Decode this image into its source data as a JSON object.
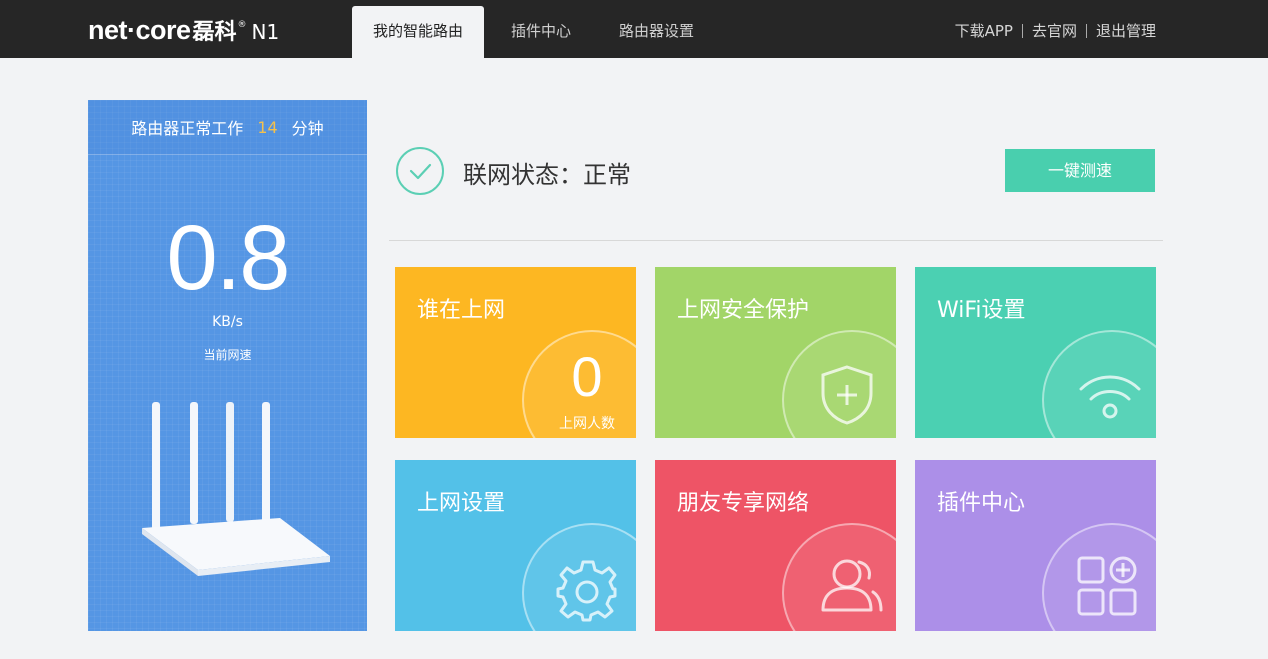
{
  "brand": {
    "name": "net·core",
    "cn": "磊科",
    "reg": "®",
    "model": "N1"
  },
  "nav": {
    "tabs": [
      {
        "label": "我的智能路由",
        "active": true
      },
      {
        "label": "插件中心",
        "active": false
      },
      {
        "label": "路由器设置",
        "active": false
      }
    ]
  },
  "header_links": [
    "下载APP",
    "去官网",
    "退出管理"
  ],
  "panel": {
    "uptime_prefix": "路由器正常工作",
    "uptime_minutes": "14",
    "uptime_unit": "分钟",
    "speed_value": "0.8",
    "speed_unit": "KB/s",
    "speed_label": "当前网速"
  },
  "status": {
    "title": "联网状态：正常",
    "speedtest_label": "一键测速"
  },
  "tiles": [
    {
      "title": "谁在上网",
      "count": "0",
      "count_label": "上网人数",
      "icon": "users-count"
    },
    {
      "title": "上网安全保护",
      "icon": "shield-plus-icon"
    },
    {
      "title": "WiFi设置",
      "icon": "wifi-icon"
    },
    {
      "title": "上网设置",
      "icon": "gear-icon"
    },
    {
      "title": "朋友专享网络",
      "icon": "users-icon"
    },
    {
      "title": "插件中心",
      "icon": "plugins-icon"
    }
  ],
  "colors": {
    "topbar": "#262626",
    "panel": "#5596e4",
    "accent": "#49cfae",
    "uptime_highlight": "#f4c14d",
    "tile_who": "#fdb722",
    "tile_security": "#a2d568",
    "tile_wifi": "#4bd0b2",
    "tile_internet": "#53c1e8",
    "tile_friends": "#ee5466",
    "tile_plugins": "#ac8fe8"
  }
}
